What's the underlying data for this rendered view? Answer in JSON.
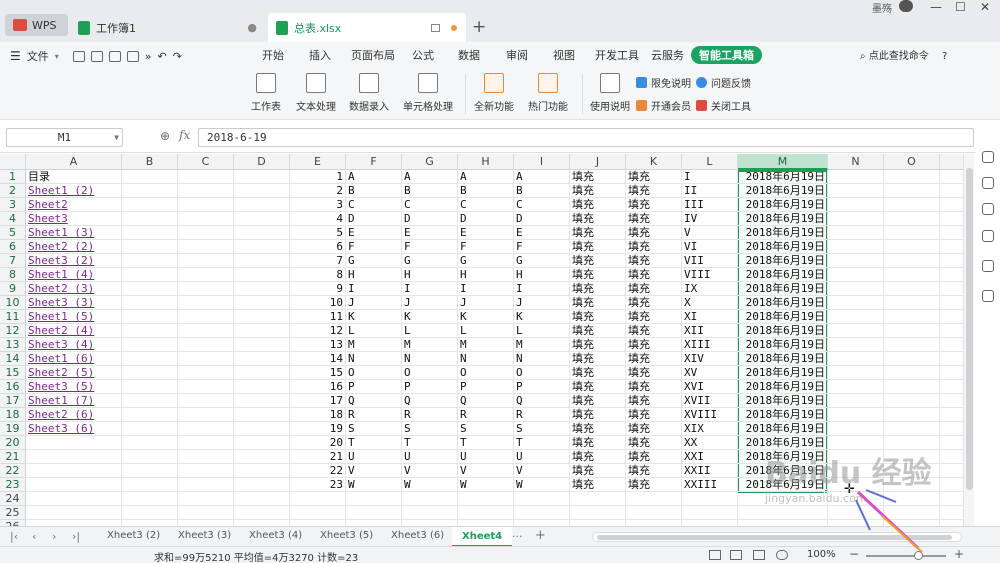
{
  "titlebar": {
    "wps_label": "WPS",
    "tab1": "工作簿1",
    "tab2": "总表.xlsx",
    "user": "墨殇",
    "new_tab": "+",
    "close": "●",
    "win_min": "—",
    "win_max": "☐",
    "win_close": "✕"
  },
  "ribbon": {
    "file_label": "文件",
    "tabs": [
      "开始",
      "插入",
      "页面布局",
      "公式",
      "数据",
      "审阅",
      "视图",
      "开发工具",
      "云服务",
      "智能工具箱"
    ],
    "search": "点此查找命令",
    "help": "?",
    "buttons": [
      "工作表",
      "文本处理",
      "数据录入",
      "单元格处理",
      "全新功能",
      "热门功能",
      "使用说明"
    ],
    "small": [
      "限免说明",
      "问题反馈",
      "开通会员",
      "关闭工具"
    ]
  },
  "formula_bar": {
    "name_box": "M1",
    "fx": "fx",
    "formula": "2018-6-19"
  },
  "grid": {
    "columns": [
      "A",
      "B",
      "C",
      "D",
      "E",
      "F",
      "G",
      "H",
      "I",
      "J",
      "K",
      "L",
      "M",
      "N",
      "O"
    ],
    "selected_column": "M",
    "rows": [
      "1",
      "2",
      "3",
      "4",
      "5",
      "6",
      "7",
      "8",
      "9",
      "10",
      "11",
      "12",
      "13",
      "14",
      "15",
      "16",
      "17",
      "18",
      "19",
      "20",
      "21",
      "22",
      "23",
      "24",
      "25",
      "26"
    ],
    "col_a": [
      "目录",
      "Sheet1 (2)",
      "Sheet2",
      "Sheet3",
      "Sheet1 (3)",
      "Sheet2 (2)",
      "Sheet3 (2)",
      "Sheet1 (4)",
      "Sheet2 (3)",
      "Sheet3 (3)",
      "Sheet1 (5)",
      "Sheet2 (4)",
      "Sheet3 (4)",
      "Sheet1 (6)",
      "Sheet2 (5)",
      "Sheet3 (5)",
      "Sheet1 (7)",
      "Sheet2 (6)",
      "Sheet3 (6)"
    ],
    "col_e": [
      "1",
      "2",
      "3",
      "4",
      "5",
      "6",
      "7",
      "8",
      "9",
      "10",
      "11",
      "12",
      "13",
      "14",
      "15",
      "16",
      "17",
      "18",
      "19",
      "20",
      "21",
      "22",
      "23"
    ],
    "letters": [
      "A",
      "B",
      "C",
      "D",
      "E",
      "F",
      "G",
      "H",
      "I",
      "J",
      "K",
      "L",
      "M",
      "N",
      "O",
      "P",
      "Q",
      "R",
      "S",
      "T",
      "U",
      "V",
      "W"
    ],
    "fill": "填充",
    "roman": [
      "I",
      "II",
      "III",
      "IV",
      "V",
      "VI",
      "VII",
      "VIII",
      "IX",
      "X",
      "XI",
      "XII",
      "XIII",
      "XIV",
      "XV",
      "XVI",
      "XVII",
      "XVIII",
      "XIX",
      "XX",
      "XXI",
      "XXII",
      "XXIII"
    ],
    "date": "2018年6月19日"
  },
  "sheets": {
    "tabs": [
      "Xheet3 (2)",
      "Xheet3 (3)",
      "Xheet3 (4)",
      "Xheet3 (5)",
      "Xheet3 (6)",
      "Xheet4"
    ],
    "active": "Xheet4",
    "more": "···",
    "add": "+"
  },
  "status": {
    "stats": "求和=99万5210  平均值=4万3270  计数=23",
    "zoom": "100%",
    "zoom_level": 100
  },
  "watermark": {
    "line1": "Baidu 经验",
    "line2": "jingyan.baidu.com"
  }
}
